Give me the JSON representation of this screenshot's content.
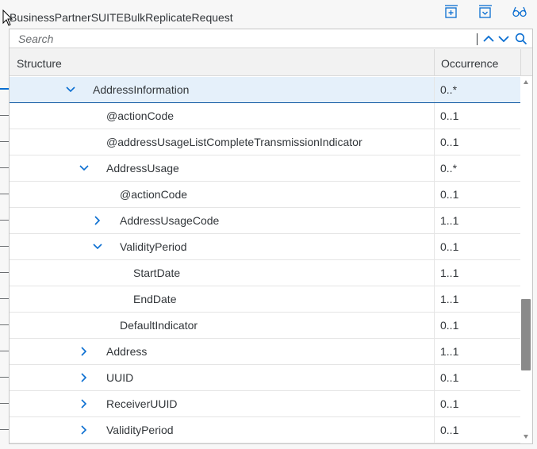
{
  "header": {
    "title": "BusinessPartnerSUITEBulkReplicateRequest",
    "icons": [
      "expand-all-icon",
      "collapse-all-icon",
      "glasses-icon"
    ]
  },
  "search": {
    "placeholder": "Search",
    "value": ""
  },
  "columns": {
    "structure": "Structure",
    "occurrence": "Occurrence"
  },
  "rows": [
    {
      "label": "AddressInformation",
      "occurrence": "0..*",
      "level": 1,
      "toggle": "expanded",
      "selected": true
    },
    {
      "label": "@actionCode",
      "occurrence": "0..1",
      "level": 2,
      "toggle": "none"
    },
    {
      "label": "@addressUsageListCompleteTransmissionIndicator",
      "occurrence": "0..1",
      "level": 2,
      "toggle": "none"
    },
    {
      "label": "AddressUsage",
      "occurrence": "0..*",
      "level": 2,
      "toggle": "expanded"
    },
    {
      "label": "@actionCode",
      "occurrence": "0..1",
      "level": 3,
      "toggle": "none"
    },
    {
      "label": "AddressUsageCode",
      "occurrence": "1..1",
      "level": 3,
      "toggle": "collapsed"
    },
    {
      "label": "ValidityPeriod",
      "occurrence": "0..1",
      "level": 3,
      "toggle": "expanded"
    },
    {
      "label": "StartDate",
      "occurrence": "1..1",
      "level": 4,
      "toggle": "none"
    },
    {
      "label": "EndDate",
      "occurrence": "1..1",
      "level": 4,
      "toggle": "none"
    },
    {
      "label": "DefaultIndicator",
      "occurrence": "0..1",
      "level": 3,
      "toggle": "none"
    },
    {
      "label": "Address",
      "occurrence": "1..1",
      "level": 2,
      "toggle": "collapsed"
    },
    {
      "label": "UUID",
      "occurrence": "0..1",
      "level": 2,
      "toggle": "collapsed"
    },
    {
      "label": "ReceiverUUID",
      "occurrence": "0..1",
      "level": 2,
      "toggle": "collapsed"
    },
    {
      "label": "ValidityPeriod",
      "occurrence": "0..1",
      "level": 2,
      "toggle": "collapsed"
    }
  ],
  "colors": {
    "accent": "#0a6ed1",
    "selected_bg": "#e5f0fa",
    "text": "#32363a",
    "border": "#c7c7c7"
  }
}
